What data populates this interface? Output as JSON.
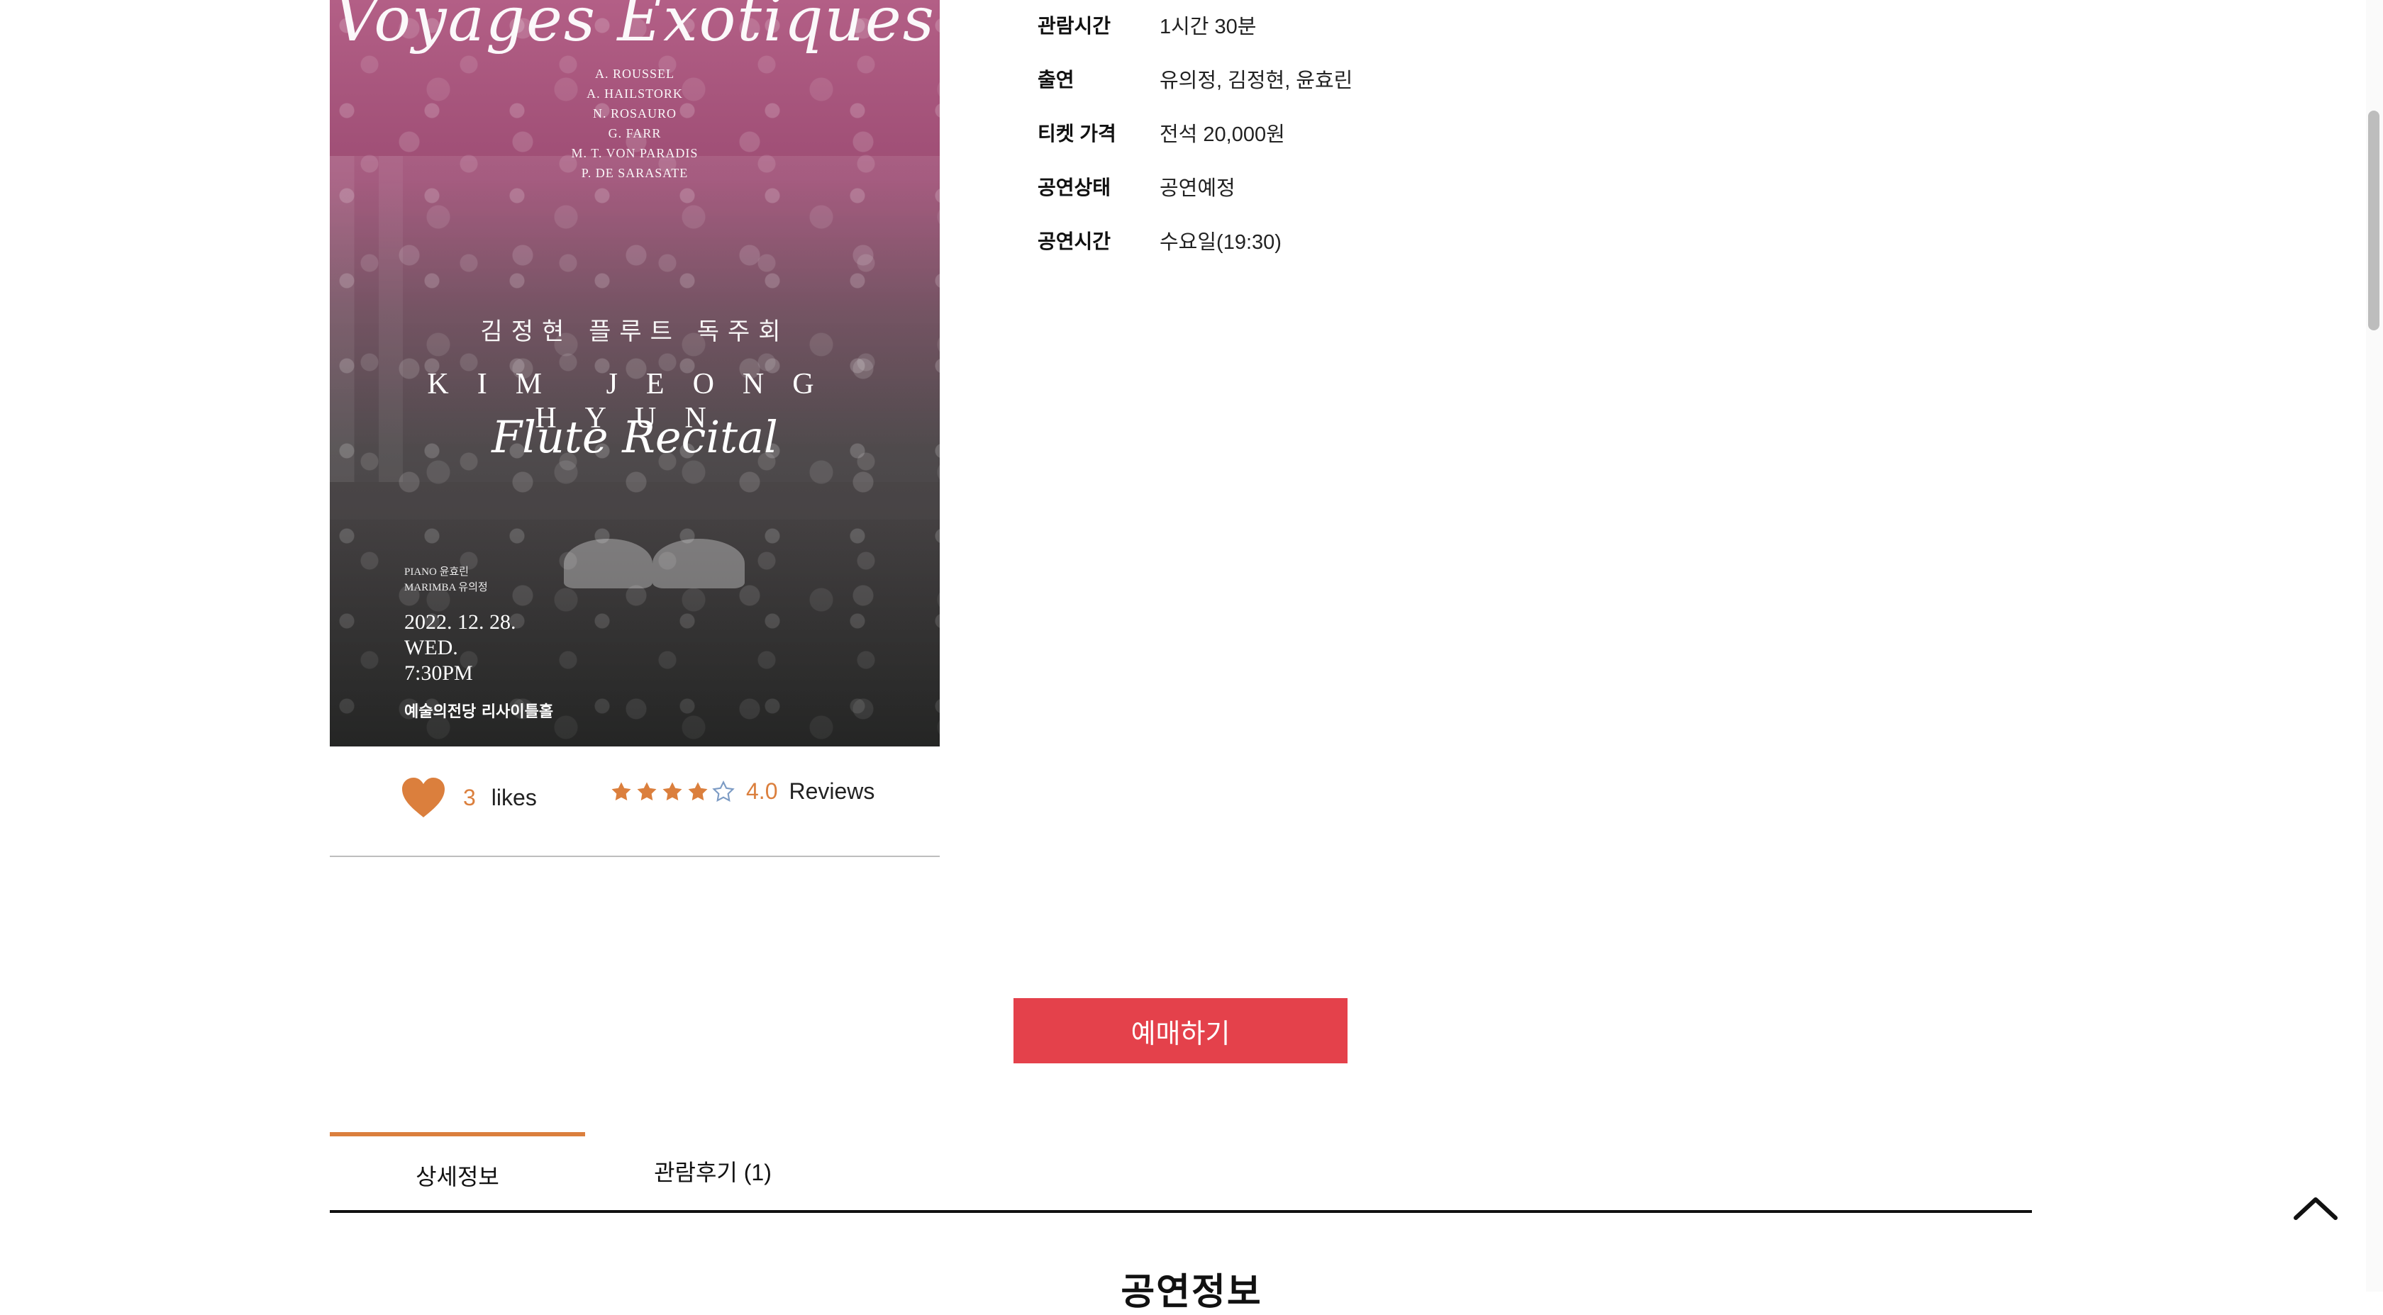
{
  "poster": {
    "title_script": "Voyages Exotiques",
    "composers": [
      "A. ROUSSEL",
      "A. HAILSTORK",
      "N. ROSAURO",
      "G. FARR",
      "M. T. VON PARADIS",
      "P. DE SARASATE"
    ],
    "korean_title": "김정현 플루트 독주회",
    "english_title": "KIM JEONG HYUN",
    "subtitle": "Flute Recital",
    "performers": [
      "PIANO 윤효린",
      "MARIMBA 유의정"
    ],
    "date": "2022. 12. 28.",
    "day": "WED.",
    "time": "7:30PM",
    "venue": "예술의전당 리사이틀홀"
  },
  "social": {
    "likes_count": "3",
    "likes_label": "likes",
    "rating": 4,
    "rating_max": 5,
    "score": "4.0",
    "reviews_label": "Reviews"
  },
  "info": {
    "runtime_label": "관람시간",
    "runtime_value": "1시간 30분",
    "cast_label": "출연",
    "cast_value": "유의정, 김정현, 윤효린",
    "price_label": "티켓 가격",
    "price_value": "전석 20,000원",
    "status_label": "공연상태",
    "status_value": "공연예정",
    "time_label": "공연시간",
    "time_value": "수요일(19:30)"
  },
  "actions": {
    "reserve_label": "예매하기"
  },
  "tabs": [
    {
      "label": "상세정보",
      "active": true
    },
    {
      "label": "관람후기 (1)",
      "active": false
    }
  ],
  "section_title": "공연정보",
  "colors": {
    "accent": "#db7f3d",
    "reserve": "#e4414b"
  },
  "icons": [
    "heart-icon",
    "star-icon",
    "chevron-up-icon"
  ]
}
